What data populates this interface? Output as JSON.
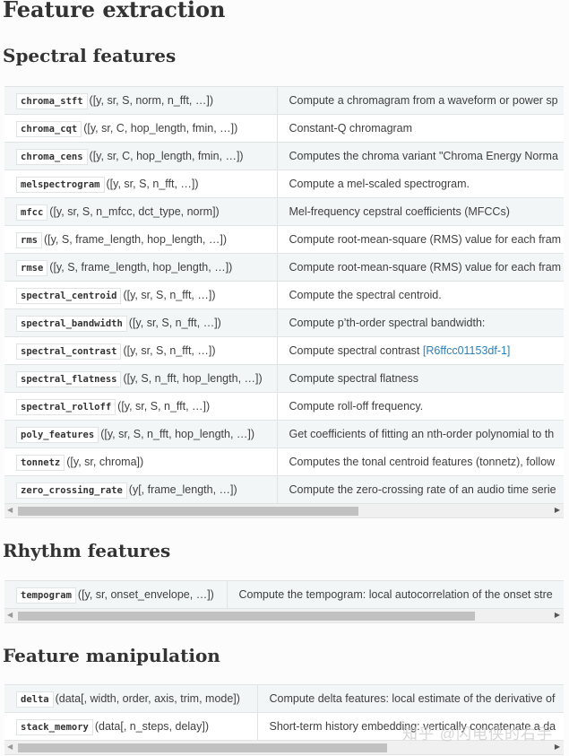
{
  "title": "Feature extraction",
  "sections": [
    {
      "heading": "Spectral features",
      "rows": [
        {
          "name": "chroma_stft",
          "sig": "([y, sr, S, norm, n_fft, …])",
          "desc": "Compute a chromagram from a waveform or power sp"
        },
        {
          "name": "chroma_cqt",
          "sig": "([y, sr, C, hop_length, fmin, …])",
          "desc": "Constant-Q chromagram"
        },
        {
          "name": "chroma_cens",
          "sig": "([y, sr, C, hop_length, fmin, …])",
          "desc": "Computes the chroma variant \"Chroma Energy Norma"
        },
        {
          "name": "melspectrogram",
          "sig": "([y, sr, S, n_fft, …])",
          "desc": "Compute a mel-scaled spectrogram."
        },
        {
          "name": "mfcc",
          "sig": "([y, sr, S, n_mfcc, dct_type, norm])",
          "desc": "Mel-frequency cepstral coefficients (MFCCs)"
        },
        {
          "name": "rms",
          "sig": "([y, S, frame_length, hop_length, …])",
          "desc": "Compute root-mean-square (RMS) value for each fram"
        },
        {
          "name": "rmse",
          "sig": "([y, S, frame_length, hop_length, …])",
          "desc": "Compute root-mean-square (RMS) value for each fram"
        },
        {
          "name": "spectral_centroid",
          "sig": "([y, sr, S, n_fft, …])",
          "desc": "Compute the spectral centroid."
        },
        {
          "name": "spectral_bandwidth",
          "sig": "([y, sr, S, n_fft, …])",
          "desc": "Compute p’th-order spectral bandwidth:"
        },
        {
          "name": "spectral_contrast",
          "sig": "([y, sr, S, n_fft, …])",
          "desc": "Compute spectral contrast",
          "link": "[R6ffcc01153df-1]"
        },
        {
          "name": "spectral_flatness",
          "sig": "([y, S, n_fft, hop_length, …])",
          "desc": "Compute spectral flatness"
        },
        {
          "name": "spectral_rolloff",
          "sig": "([y, sr, S, n_fft, …])",
          "desc": "Compute roll-off frequency."
        },
        {
          "name": "poly_features",
          "sig": "([y, sr, S, n_fft, hop_length, …])",
          "desc": "Get coefficients of fitting an nth-order polynomial to th"
        },
        {
          "name": "tonnetz",
          "sig": "([y, sr, chroma])",
          "desc": "Computes the tonal centroid features (tonnetz), follow"
        },
        {
          "name": "zero_crossing_rate",
          "sig": "(y[, frame_length, …])",
          "desc": "Compute the zero-crossing rate of an audio time serie"
        }
      ]
    },
    {
      "heading": "Rhythm features",
      "rows": [
        {
          "name": "tempogram",
          "sig": "([y, sr, onset_envelope, …])",
          "desc": "Compute the tempogram: local autocorrelation of the onset stre"
        }
      ]
    },
    {
      "heading": "Feature manipulation",
      "rows": [
        {
          "name": "delta",
          "sig": "(data[, width, order, axis, trim, mode])",
          "desc": "Compute delta features: local estimate of the derivative of"
        },
        {
          "name": "stack_memory",
          "sig": "(data[, n_steps, delay])",
          "desc": "Short-term history embedding: vertically concatenate a da"
        }
      ]
    }
  ],
  "watermark": "知乎 @闪电侠的右手"
}
